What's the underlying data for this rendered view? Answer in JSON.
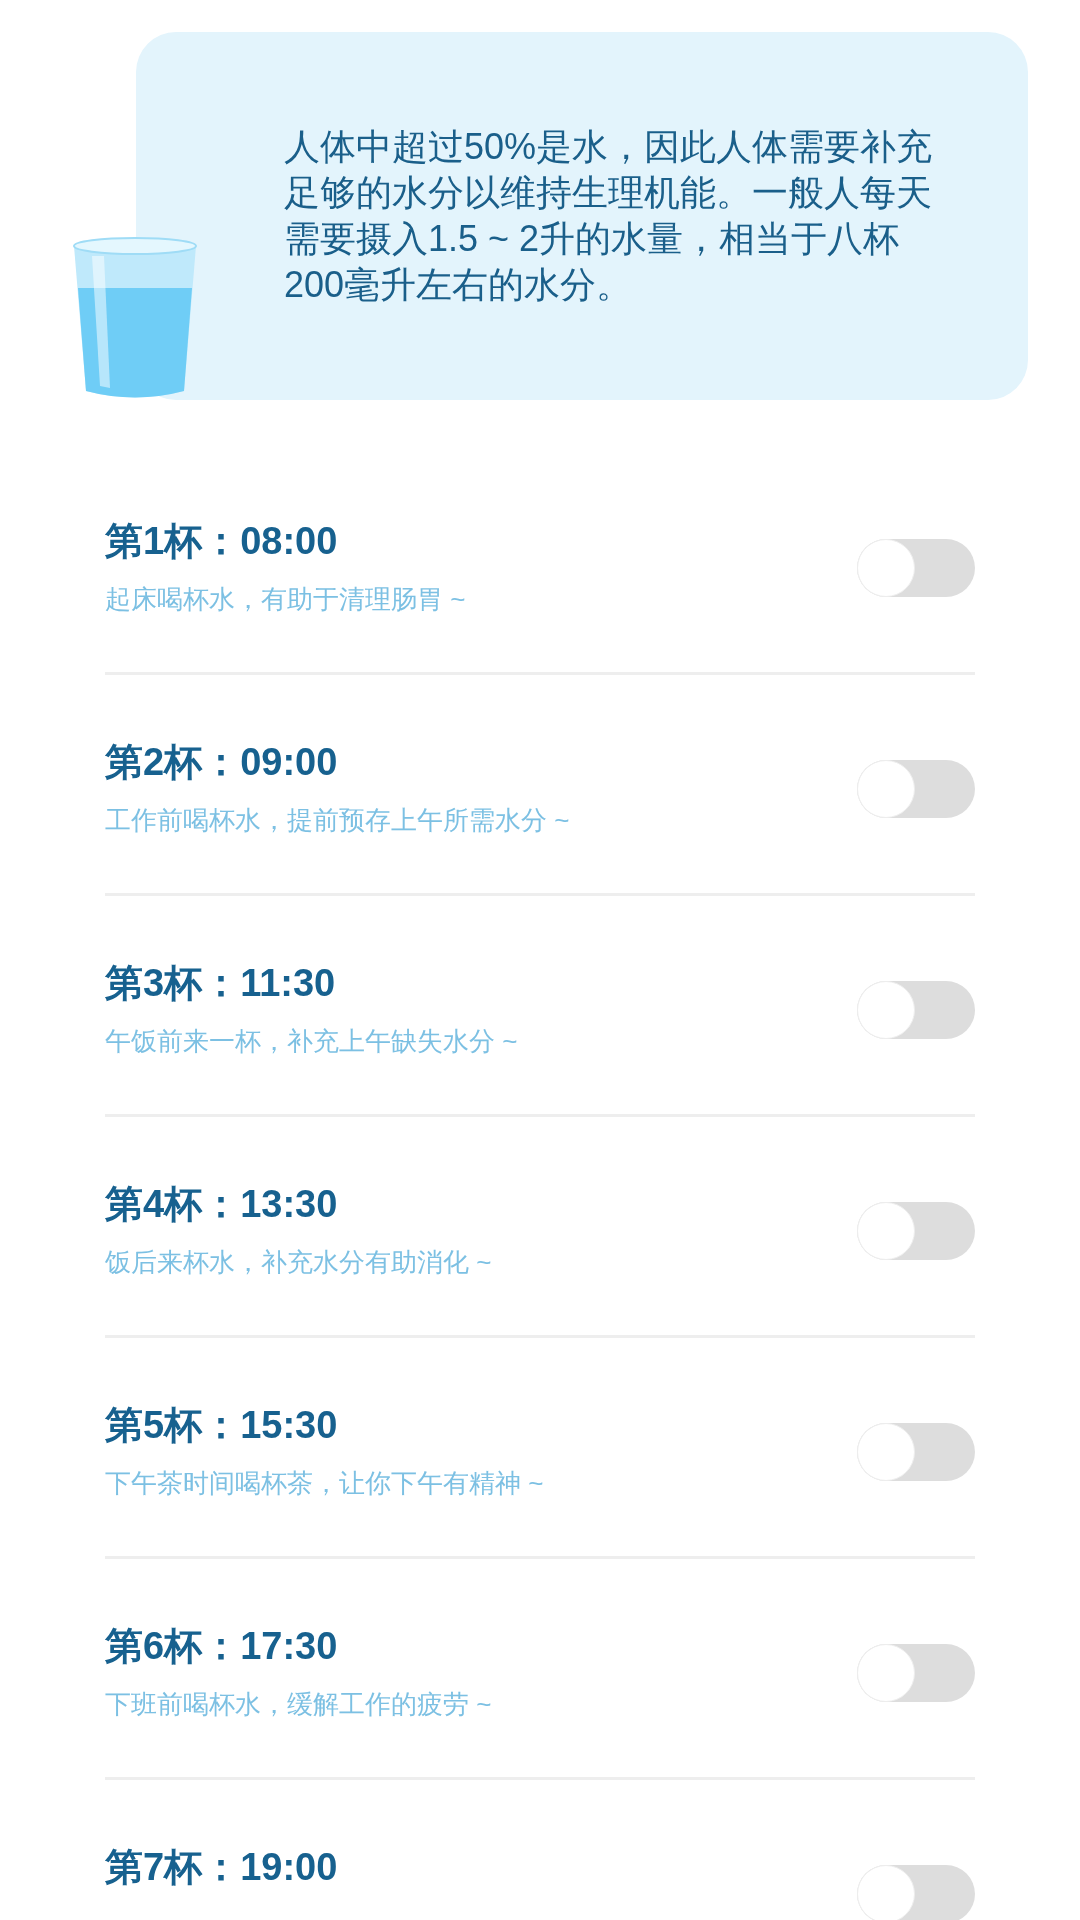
{
  "intro": {
    "text": "人体中超过50%是水，因此人体需要补充足够的水分以维持生理机能。一般人每天需要摄入1.5 ~ 2升的水量，相当于八杯200毫升左右的水分。"
  },
  "reminders": [
    {
      "title": "第1杯：08:00",
      "note": "起床喝杯水，有助于清理肠胃 ~",
      "on": false
    },
    {
      "title": "第2杯：09:00",
      "note": "工作前喝杯水，提前预存上午所需水分 ~",
      "on": false
    },
    {
      "title": "第3杯：11:30",
      "note": "午饭前来一杯，补充上午缺失水分 ~",
      "on": false
    },
    {
      "title": "第4杯：13:30",
      "note": "饭后来杯水，补充水分有助消化 ~",
      "on": false
    },
    {
      "title": "第5杯：15:30",
      "note": "下午茶时间喝杯茶，让你下午有精神 ~",
      "on": false
    },
    {
      "title": "第6杯：17:30",
      "note": "下班前喝杯水，缓解工作的疲劳 ~",
      "on": false
    },
    {
      "title": "第7杯：19:00",
      "on": false
    }
  ]
}
